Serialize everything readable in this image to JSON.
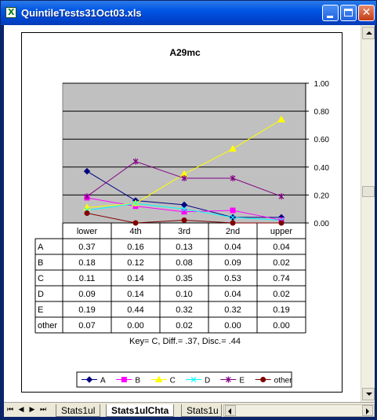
{
  "window": {
    "title": "QuintileTests31Oct03.xls"
  },
  "tabs": [
    {
      "label": "Stats1ul"
    },
    {
      "label": "Stats1ulChta"
    },
    {
      "label": "Stats1u"
    }
  ],
  "icons": {
    "app": "excel-app-icon",
    "minimize": "minimize-icon",
    "maximize": "maximize-icon",
    "close": "close-icon"
  },
  "chart_data": {
    "type": "line",
    "title": "A29mc",
    "categories": [
      "lower",
      "4th",
      "3rd",
      "2nd",
      "upper"
    ],
    "ylim": [
      0,
      1
    ],
    "yticks": [
      "0.00",
      "0.20",
      "0.40",
      "0.60",
      "0.80",
      "1.00"
    ],
    "y_axis_side": "right",
    "grid": true,
    "plot_background": "#c0c0c0",
    "series": [
      {
        "name": "A",
        "values": [
          0.37,
          0.16,
          0.13,
          0.04,
          0.04
        ],
        "display": [
          "0.37",
          "0.16",
          "0.13",
          "0.04",
          "0.04"
        ],
        "color": "#000080",
        "marker": "diamond"
      },
      {
        "name": "B",
        "values": [
          0.18,
          0.12,
          0.08,
          0.09,
          0.02
        ],
        "display": [
          "0.18",
          "0.12",
          "0.08",
          "0.09",
          "0.02"
        ],
        "color": "#ff00ff",
        "marker": "square"
      },
      {
        "name": "C",
        "values": [
          0.11,
          0.14,
          0.35,
          0.53,
          0.74
        ],
        "display": [
          "0.11",
          "0.14",
          "0.35",
          "0.53",
          "0.74"
        ],
        "color": "#ffff00",
        "marker": "triangle"
      },
      {
        "name": "D",
        "values": [
          0.09,
          0.14,
          0.1,
          0.04,
          0.02
        ],
        "display": [
          "0.09",
          "0.14",
          "0.10",
          "0.04",
          "0.02"
        ],
        "color": "#00ffff",
        "marker": "x"
      },
      {
        "name": "E",
        "values": [
          0.19,
          0.44,
          0.32,
          0.32,
          0.19
        ],
        "display": [
          "0.19",
          "0.44",
          "0.32",
          "0.32",
          "0.19"
        ],
        "color": "#800080",
        "marker": "star"
      },
      {
        "name": "other",
        "values": [
          0.07,
          0.0,
          0.02,
          0.0,
          0.0
        ],
        "display": [
          "0.07",
          "0.00",
          "0.02",
          "0.00",
          "0.00"
        ],
        "color": "#800000",
        "marker": "circle"
      }
    ],
    "annotation": "Key= C,  Diff.= .37,  Disc.= .44",
    "legend_position": "bottom"
  }
}
